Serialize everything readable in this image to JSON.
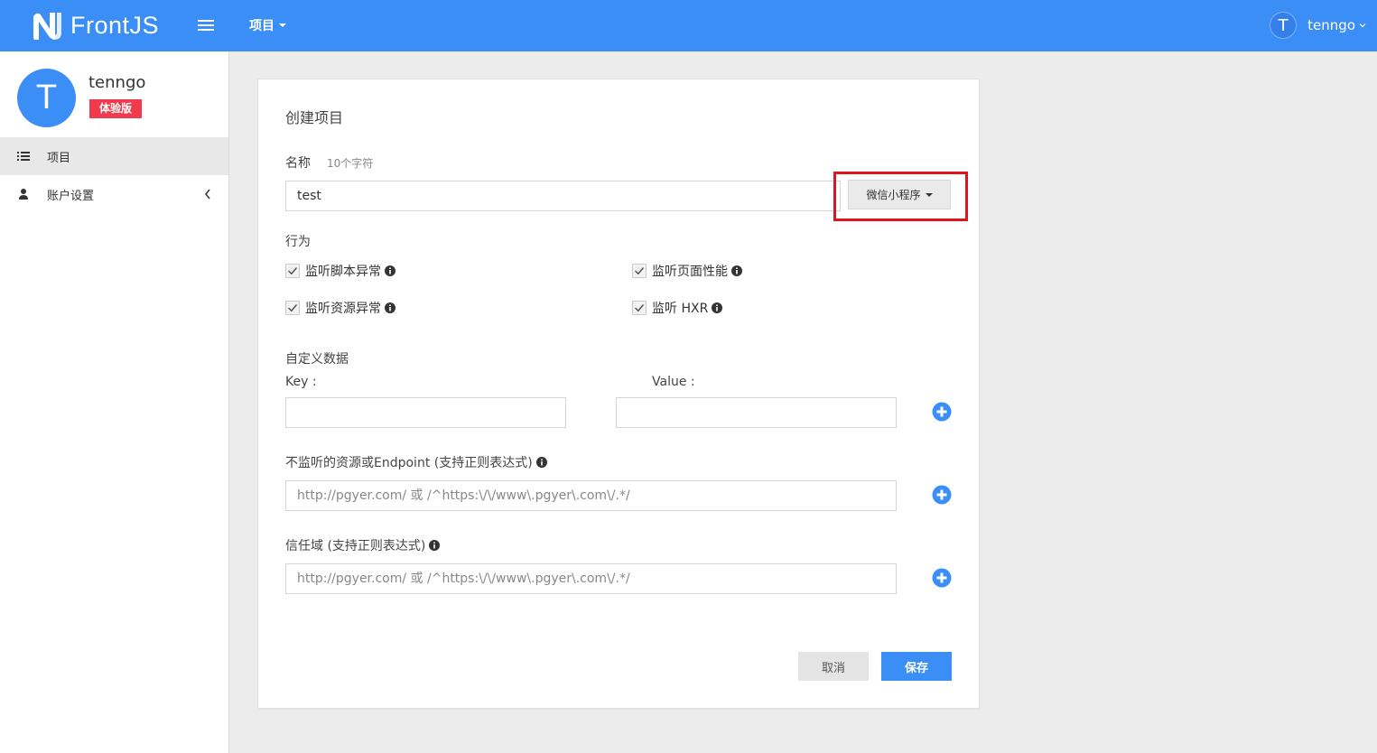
{
  "app": {
    "brand": "FrontJS",
    "project_menu_label": "项目",
    "user_name": "tenngo",
    "user_initial": "T"
  },
  "colors": {
    "primary": "#3a8ef6",
    "badge": "#f03a4e",
    "highlight": "#e0141f"
  },
  "sidebar": {
    "profile": {
      "initial": "T",
      "name": "tenngo",
      "badge": "体验版"
    },
    "items": [
      {
        "label": "项目",
        "icon": "list-icon",
        "active": true
      },
      {
        "label": "账户设置",
        "icon": "user-icon",
        "active": false
      }
    ]
  },
  "form": {
    "title": "创建项目",
    "name_label": "名称",
    "name_hint": "10个字符",
    "name_value": "test",
    "type_select": "微信小程序",
    "behavior_label": "行为",
    "checkboxes": [
      {
        "label": "监听脚本异常",
        "checked": true
      },
      {
        "label": "监听页面性能",
        "checked": true
      },
      {
        "label": "监听资源异常",
        "checked": true
      },
      {
        "label": "监听 HXR",
        "checked": true
      }
    ],
    "custom_data_label": "自定义数据",
    "key_label": "Key :",
    "value_label": "Value :",
    "key_value": "",
    "value_value": "",
    "ignore_label": "不监听的资源或Endpoint (支持正则表达式)",
    "ignore_placeholder": "http://pgyer.com/ 或 /^https:\\/\\/www\\.pgyer\\.com\\/.*/",
    "trust_label": "信任域 (支持正则表达式)",
    "trust_placeholder": "http://pgyer.com/ 或 /^https:\\/\\/www\\.pgyer\\.com\\/.*/",
    "cancel_label": "取消",
    "save_label": "保存"
  }
}
